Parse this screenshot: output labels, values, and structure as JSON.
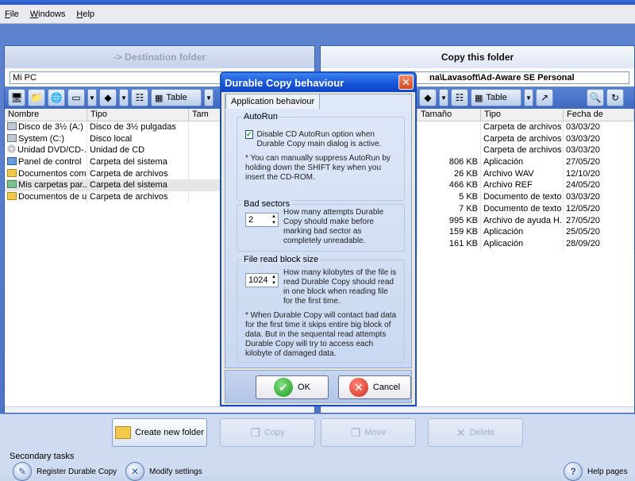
{
  "menu": [
    "File",
    "Windows",
    "Help"
  ],
  "left_pane": {
    "header": "-> Destination folder",
    "path": "Mi PC",
    "view_label": "Table",
    "columns": [
      "Nombre",
      "Tipo",
      "Tam"
    ],
    "rows": [
      {
        "icon": "drive",
        "name": "Disco de 3½ (A:)",
        "type": "Disco de 3½ pulgadas"
      },
      {
        "icon": "drive",
        "name": "System (C:)",
        "type": "Disco local"
      },
      {
        "icon": "cd",
        "name": "Unidad DVD/CD-...",
        "type": "Unidad de CD"
      },
      {
        "icon": "ctrl",
        "name": "Panel de control",
        "type": "Carpeta del sistema"
      },
      {
        "icon": "folder",
        "name": "Documentos com...",
        "type": "Carpeta de archivos"
      },
      {
        "icon": "user",
        "name": "Mis carpetas par...",
        "type": "Carpeta del sistema"
      },
      {
        "icon": "folder",
        "name": "Documentos de u...",
        "type": "Carpeta de archivos"
      }
    ]
  },
  "right_pane": {
    "header": "Copy this folder",
    "path": "na\\Lavasoft\\Ad-Aware SE Personal",
    "view_label": "Table",
    "columns": [
      "Tamaño",
      "Tipo",
      "Fecha de"
    ],
    "rows": [
      {
        "size": "",
        "type": "Carpeta de archivos",
        "date": "03/03/20"
      },
      {
        "size": "",
        "type": "Carpeta de archivos",
        "date": "03/03/20"
      },
      {
        "size": "",
        "type": "Carpeta de archivos",
        "date": "03/03/20"
      },
      {
        "size": "806 KB",
        "type": "Aplicación",
        "date": "27/05/20"
      },
      {
        "size": "26 KB",
        "type": "Archivo WAV",
        "date": "12/10/20"
      },
      {
        "size": "466 KB",
        "type": "Archivo REF",
        "date": "24/05/20"
      },
      {
        "size": "5 KB",
        "type": "Documento de texto",
        "date": "03/03/20"
      },
      {
        "size": "7 KB",
        "type": "Documento de texto",
        "date": "12/05/20"
      },
      {
        "size": "995 KB",
        "type": "Archivo de ayuda H...",
        "date": "27/05/20"
      },
      {
        "size": "159 KB",
        "type": "Aplicación",
        "date": "25/05/20"
      },
      {
        "size": "161 KB",
        "type": "Aplicación",
        "date": "28/09/20"
      }
    ]
  },
  "actions": {
    "create": "Create new folder",
    "copy": "Copy",
    "move": "Move",
    "delete": "Delete"
  },
  "tasks": {
    "label": "Secondary tasks",
    "register": "Register Durable Copy",
    "modify": "Modify settings",
    "help": "Help pages"
  },
  "dialog": {
    "title": "Durable Copy behaviour",
    "tab": "Application behaviour",
    "autorun": {
      "title": "AutoRun",
      "checkbox_label": "Disable CD AutoRun option when Durable Copy main dialog is active.",
      "checked": true,
      "note": "* You can manually suppress AutoRun by holding down the SHIFT key when you insert the CD-ROM."
    },
    "bad_sectors": {
      "title": "Bad sectors",
      "value": "2",
      "label": "How many attempts Durable Copy should make before marking bad sector as completely unreadable."
    },
    "block_size": {
      "title": "File read block size",
      "value": "1024",
      "label": "How many kilobytes of the file is read Durable Copy should read in one block when reading file for the first time.",
      "note": "* When Durable Copy will contact bad data for the first time it skips entire big block of data. But in the sequental read attempts Durable Copy will try to access each kilobyte of damaged data."
    },
    "ok": "OK",
    "cancel": "Cancel"
  }
}
